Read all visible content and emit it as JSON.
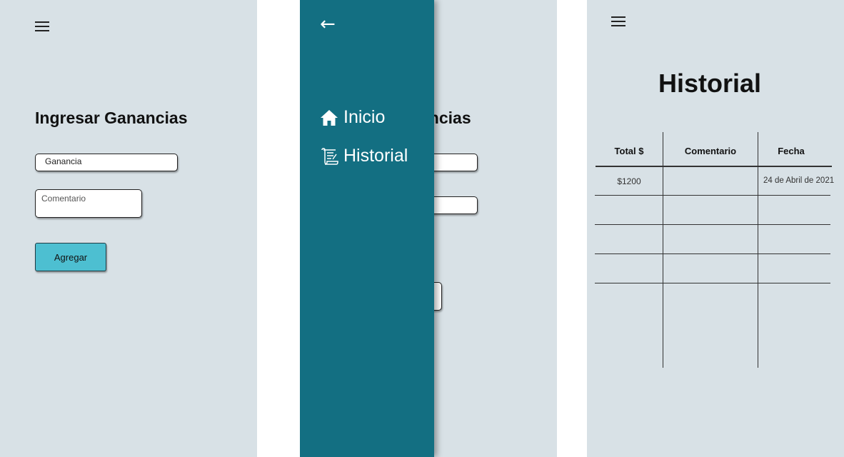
{
  "screen1": {
    "title": "Ingresar Ganancias",
    "ganancia_field": {
      "value": "Ganancia"
    },
    "comentario_field": {
      "value": "Comentario"
    },
    "submit_label": "Agregar"
  },
  "screen2": {
    "title_visible": "ancias",
    "drawer": {
      "back_glyph": "←",
      "items": [
        {
          "label": "Inicio",
          "icon": "home-icon"
        },
        {
          "label": "Historial",
          "icon": "scroll-icon"
        }
      ]
    }
  },
  "screen3": {
    "title": "Historial",
    "table": {
      "columns": [
        "Total $",
        "Comentario",
        "Fecha"
      ],
      "rows": [
        [
          "$1200",
          "",
          "24 de Abril de 2021"
        ]
      ]
    }
  },
  "colors": {
    "screen_bg": "#d8e1e6",
    "drawer_bg": "#136f82",
    "button_bg": "#4dbfd1"
  }
}
